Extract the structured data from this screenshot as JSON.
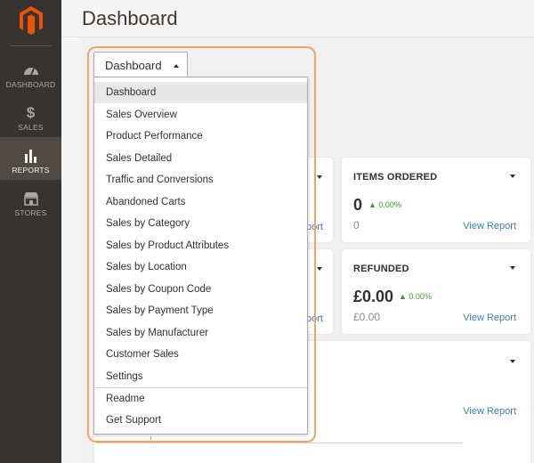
{
  "sidebar": {
    "items": [
      {
        "label": "DASHBOARD",
        "icon": "speedometer-icon"
      },
      {
        "label": "SALES",
        "icon": "dollar-icon"
      },
      {
        "label": "REPORTS",
        "icon": "bar-chart-icon"
      },
      {
        "label": "STORES",
        "icon": "storefront-icon"
      }
    ],
    "active_index": 2
  },
  "page": {
    "title": "Dashboard"
  },
  "dropdown": {
    "selected_label": "Dashboard",
    "items": [
      "Dashboard",
      "Sales Overview",
      "Product Performance",
      "Sales Detailed",
      "Traffic and Conversions",
      "Abandoned Carts",
      "Sales by Category",
      "Sales by Product Attributes",
      "Sales by Location",
      "Sales by Coupon Code",
      "Sales by Payment Type",
      "Sales by Manufacturer",
      "Customer Sales",
      "Settings",
      "Readme",
      "Get Support"
    ]
  },
  "cards": {
    "items_ordered": {
      "title": "ITEMS ORDERED",
      "value": "0",
      "change": "0.00%",
      "previous": "0",
      "link": "View Report"
    },
    "refunded": {
      "title": "REFUNDED",
      "value": "£0.00",
      "change": "0.00%",
      "previous": "£0.00",
      "link": "View Report"
    },
    "bottom": {
      "link": "View Report"
    }
  },
  "partial": {
    "link_1": "port",
    "link_2": "port"
  },
  "colors": {
    "sidebar": "#373330",
    "active_nav": "#514943",
    "accent_outline": "#f0a564",
    "link": "#3b7bbf",
    "positive": "#3a9b2b",
    "logo": "#eb5202"
  }
}
